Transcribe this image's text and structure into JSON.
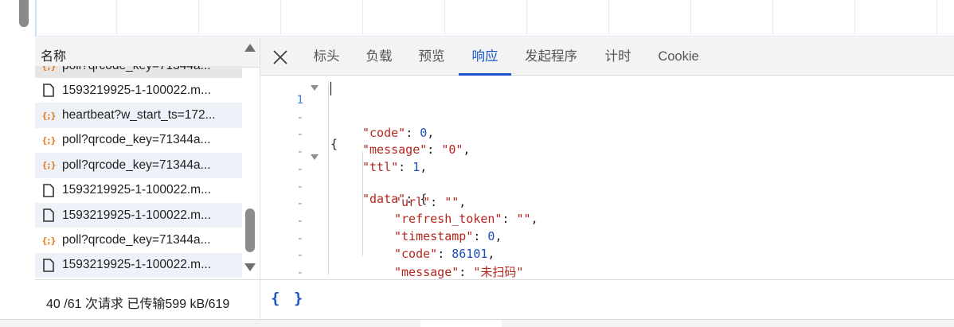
{
  "name_panel": {
    "header": "名称",
    "rows": [
      {
        "type": "fetch",
        "text": "poll?qrcode_key=71344a..."
      },
      {
        "type": "doc",
        "text": "1593219925-1-100022.m..."
      },
      {
        "type": "fetch",
        "text": "heartbeat?w_start_ts=172..."
      },
      {
        "type": "fetch",
        "text": "poll?qrcode_key=71344a..."
      },
      {
        "type": "fetch",
        "text": "poll?qrcode_key=71344a..."
      },
      {
        "type": "doc",
        "text": "1593219925-1-100022.m..."
      },
      {
        "type": "doc",
        "text": "1593219925-1-100022.m..."
      },
      {
        "type": "fetch",
        "text": "poll?qrcode_key=71344a..."
      },
      {
        "type": "doc",
        "text": "1593219925-1-100022.m..."
      }
    ]
  },
  "tabs": [
    "标头",
    "负载",
    "预览",
    "响应",
    "发起程序",
    "计时",
    "Cookie"
  ],
  "active_tab": "响应",
  "fetch_icon_glyph": "{;}",
  "code": {
    "first_line_number": "1",
    "dash": "-",
    "lines": [
      "{",
      "\"code\": 0,",
      "\"message\": \"0\",",
      "\"ttl\": 1,",
      "\"data\": {",
      "\"url\": \"\",",
      "\"refresh_token\": \"\",",
      "\"timestamp\": 0,",
      "\"code\": 86101,",
      "\"message\": \"未扫码\"",
      "}",
      "}"
    ],
    "response": {
      "code": 0,
      "message": "0",
      "ttl": 1,
      "data": {
        "url": "",
        "refresh_token": "",
        "timestamp": 0,
        "code": 86101,
        "message": "未扫码"
      }
    }
  },
  "status_bar": {
    "summary": "40 /61 次请求  已传输599 kB/619",
    "pretty_print": "{ }"
  },
  "colors": {
    "accent": "#1a56c8",
    "fetch_icon": "#e8710a",
    "json_key": "#b3261e",
    "json_number": "#1a4ec0"
  }
}
